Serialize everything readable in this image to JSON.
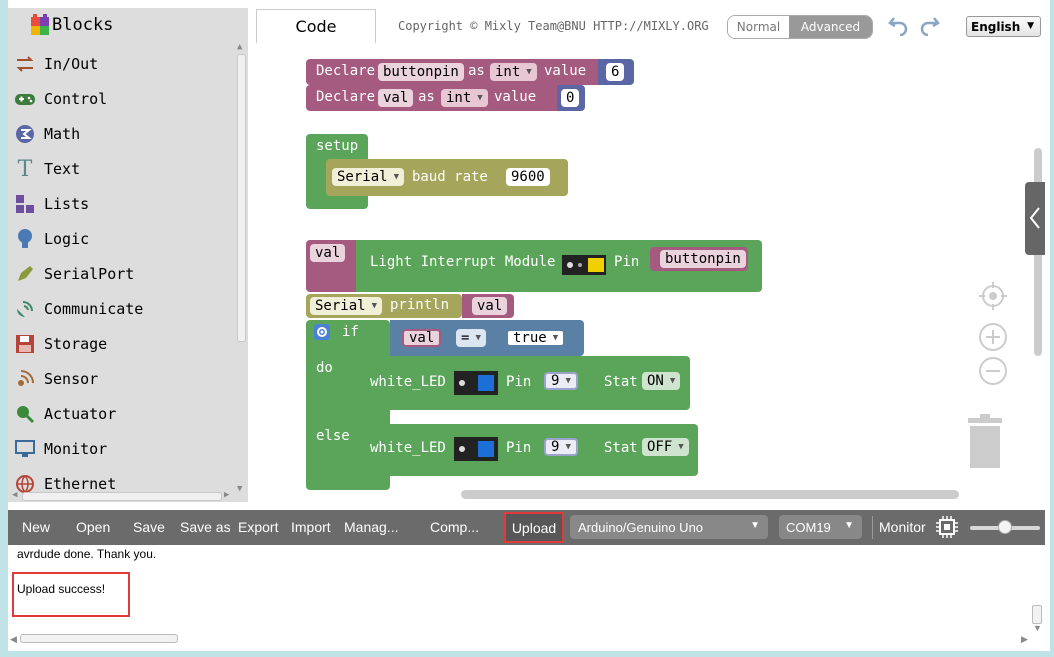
{
  "toolbox": {
    "title": "Blocks",
    "categories": [
      {
        "label": "In/Out",
        "icon": "arrows-icon",
        "color": "#a0522d"
      },
      {
        "label": "Control",
        "icon": "gamepad-icon",
        "color": "#3d7a3d"
      },
      {
        "label": "Math",
        "icon": "math-icon",
        "color": "#5b67a5"
      },
      {
        "label": "Text",
        "icon": "text-icon",
        "color": "#5b8a8a"
      },
      {
        "label": "Lists",
        "icon": "lists-icon",
        "color": "#6e4f9e"
      },
      {
        "label": "Logic",
        "icon": "bulb-icon",
        "color": "#4a7ab5"
      },
      {
        "label": "SerialPort",
        "icon": "pen-icon",
        "color": "#8a9a3a"
      },
      {
        "label": "Communicate",
        "icon": "satellite-icon",
        "color": "#3a8a6a"
      },
      {
        "label": "Storage",
        "icon": "floppy-icon",
        "color": "#b5453a"
      },
      {
        "label": "Sensor",
        "icon": "sensor-icon",
        "color": "#a56a3a"
      },
      {
        "label": "Actuator",
        "icon": "actuator-icon",
        "color": "#3a8a3a"
      },
      {
        "label": "Monitor",
        "icon": "monitor-icon",
        "color": "#3a6a9a"
      },
      {
        "label": "Ethernet",
        "icon": "globe-icon",
        "color": "#b5453a"
      }
    ]
  },
  "header": {
    "code_tab": "Code",
    "copyright": "Copyright © Mixly Team@BNU HTTP://MIXLY.ORG",
    "mode_normal": "Normal",
    "mode_advanced": "Advanced",
    "language": "English"
  },
  "workspace": {
    "declare1": {
      "kw": "Declare",
      "var": "buttonpin",
      "as": "as",
      "type": "int",
      "value_kw": "value",
      "value": "6"
    },
    "declare2": {
      "kw": "Declare",
      "var": "val",
      "as": "as",
      "type": "int",
      "value_kw": "value",
      "value": "0"
    },
    "setup": {
      "label": "setup",
      "serial": "Serial",
      "baud_text": "baud rate",
      "baud": "9600"
    },
    "assign": {
      "var": "val",
      "module": "Light Interrupt Module",
      "pin_label": "Pin",
      "pin": "buttonpin"
    },
    "println": {
      "serial": "Serial",
      "fn": "println",
      "arg": "val"
    },
    "if_block": {
      "if_kw": "if",
      "do_kw": "do",
      "else_kw": "else",
      "cond_var": "val",
      "cond_op": "=",
      "cond_val": "true"
    },
    "led_do": {
      "label": "white_LED",
      "pin_label": "Pin",
      "pin": "9",
      "stat_label": "Stat",
      "stat": "ON"
    },
    "led_else": {
      "label": "white_LED",
      "pin_label": "Pin",
      "pin": "9",
      "stat_label": "Stat",
      "stat": "OFF"
    }
  },
  "toolbar": {
    "new": "New",
    "open": "Open",
    "save": "Save",
    "save_as": "Save as",
    "export": "Export",
    "import": "Import",
    "manage": "Manag...",
    "compile": "Comp...",
    "upload": "Upload",
    "board": "Arduino/Genuino Uno",
    "port": "COM19",
    "monitor": "Monitor"
  },
  "console": {
    "line1": "avrdude done.  Thank you.",
    "line2": "Upload success!"
  },
  "colors": {
    "highlight": "#e03a3a",
    "toolbar_bg": "#6b6b6b",
    "block_purple": "#a55b80",
    "block_green": "#5ba55b",
    "block_olive": "#a5a55b",
    "block_navy": "#5b67a5"
  }
}
